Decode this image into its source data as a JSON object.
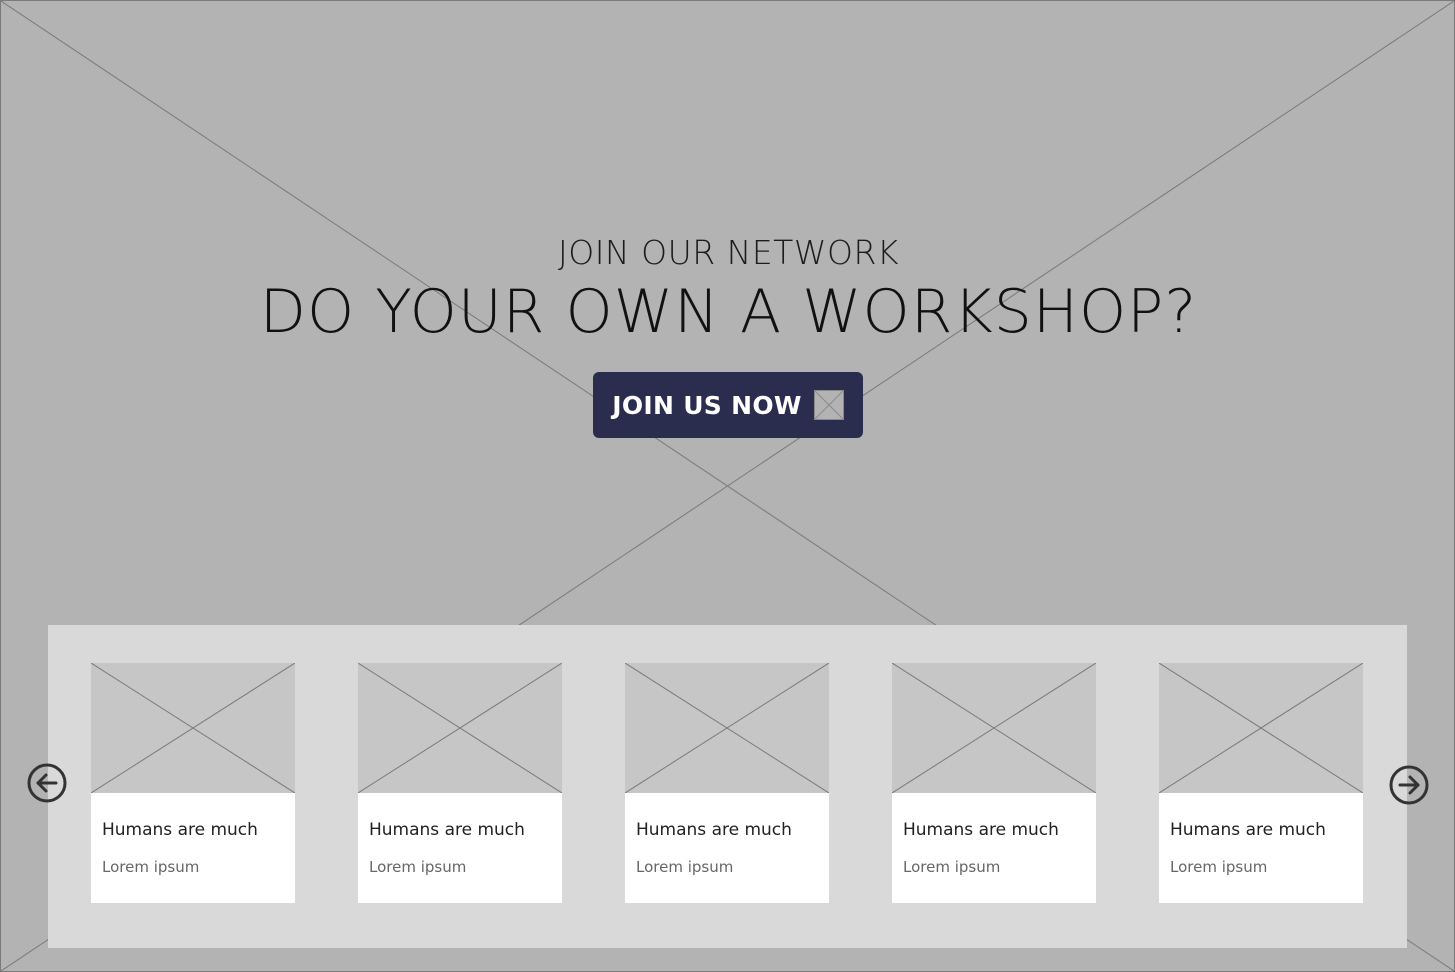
{
  "hero": {
    "kicker": "JOIN OUR NETWORK",
    "title": "DO YOUR OWN A WORKSHOP?",
    "cta_label": "JOIN US NOW",
    "cta_icon": "image-placeholder-icon",
    "background": "image-placeholder"
  },
  "carousel": {
    "prev_icon": "arrow-left-circle-icon",
    "next_icon": "arrow-right-circle-icon",
    "cards": [
      {
        "title": "Humans are much",
        "subtitle": "Lorem ipsum"
      },
      {
        "title": "Humans are much",
        "subtitle": "Lorem ipsum"
      },
      {
        "title": "Humans are much",
        "subtitle": "Lorem ipsum"
      },
      {
        "title": "Humans are much",
        "subtitle": "Lorem ipsum"
      },
      {
        "title": "Humans are much",
        "subtitle": "Lorem ipsum"
      }
    ]
  },
  "colors": {
    "background": "#b3b3b3",
    "button": "#2a2d4e",
    "carousel_panel": "#d9d9d9",
    "card": "#ffffff",
    "thumbnail": "#c6c6c6",
    "arrow": "#333333"
  }
}
